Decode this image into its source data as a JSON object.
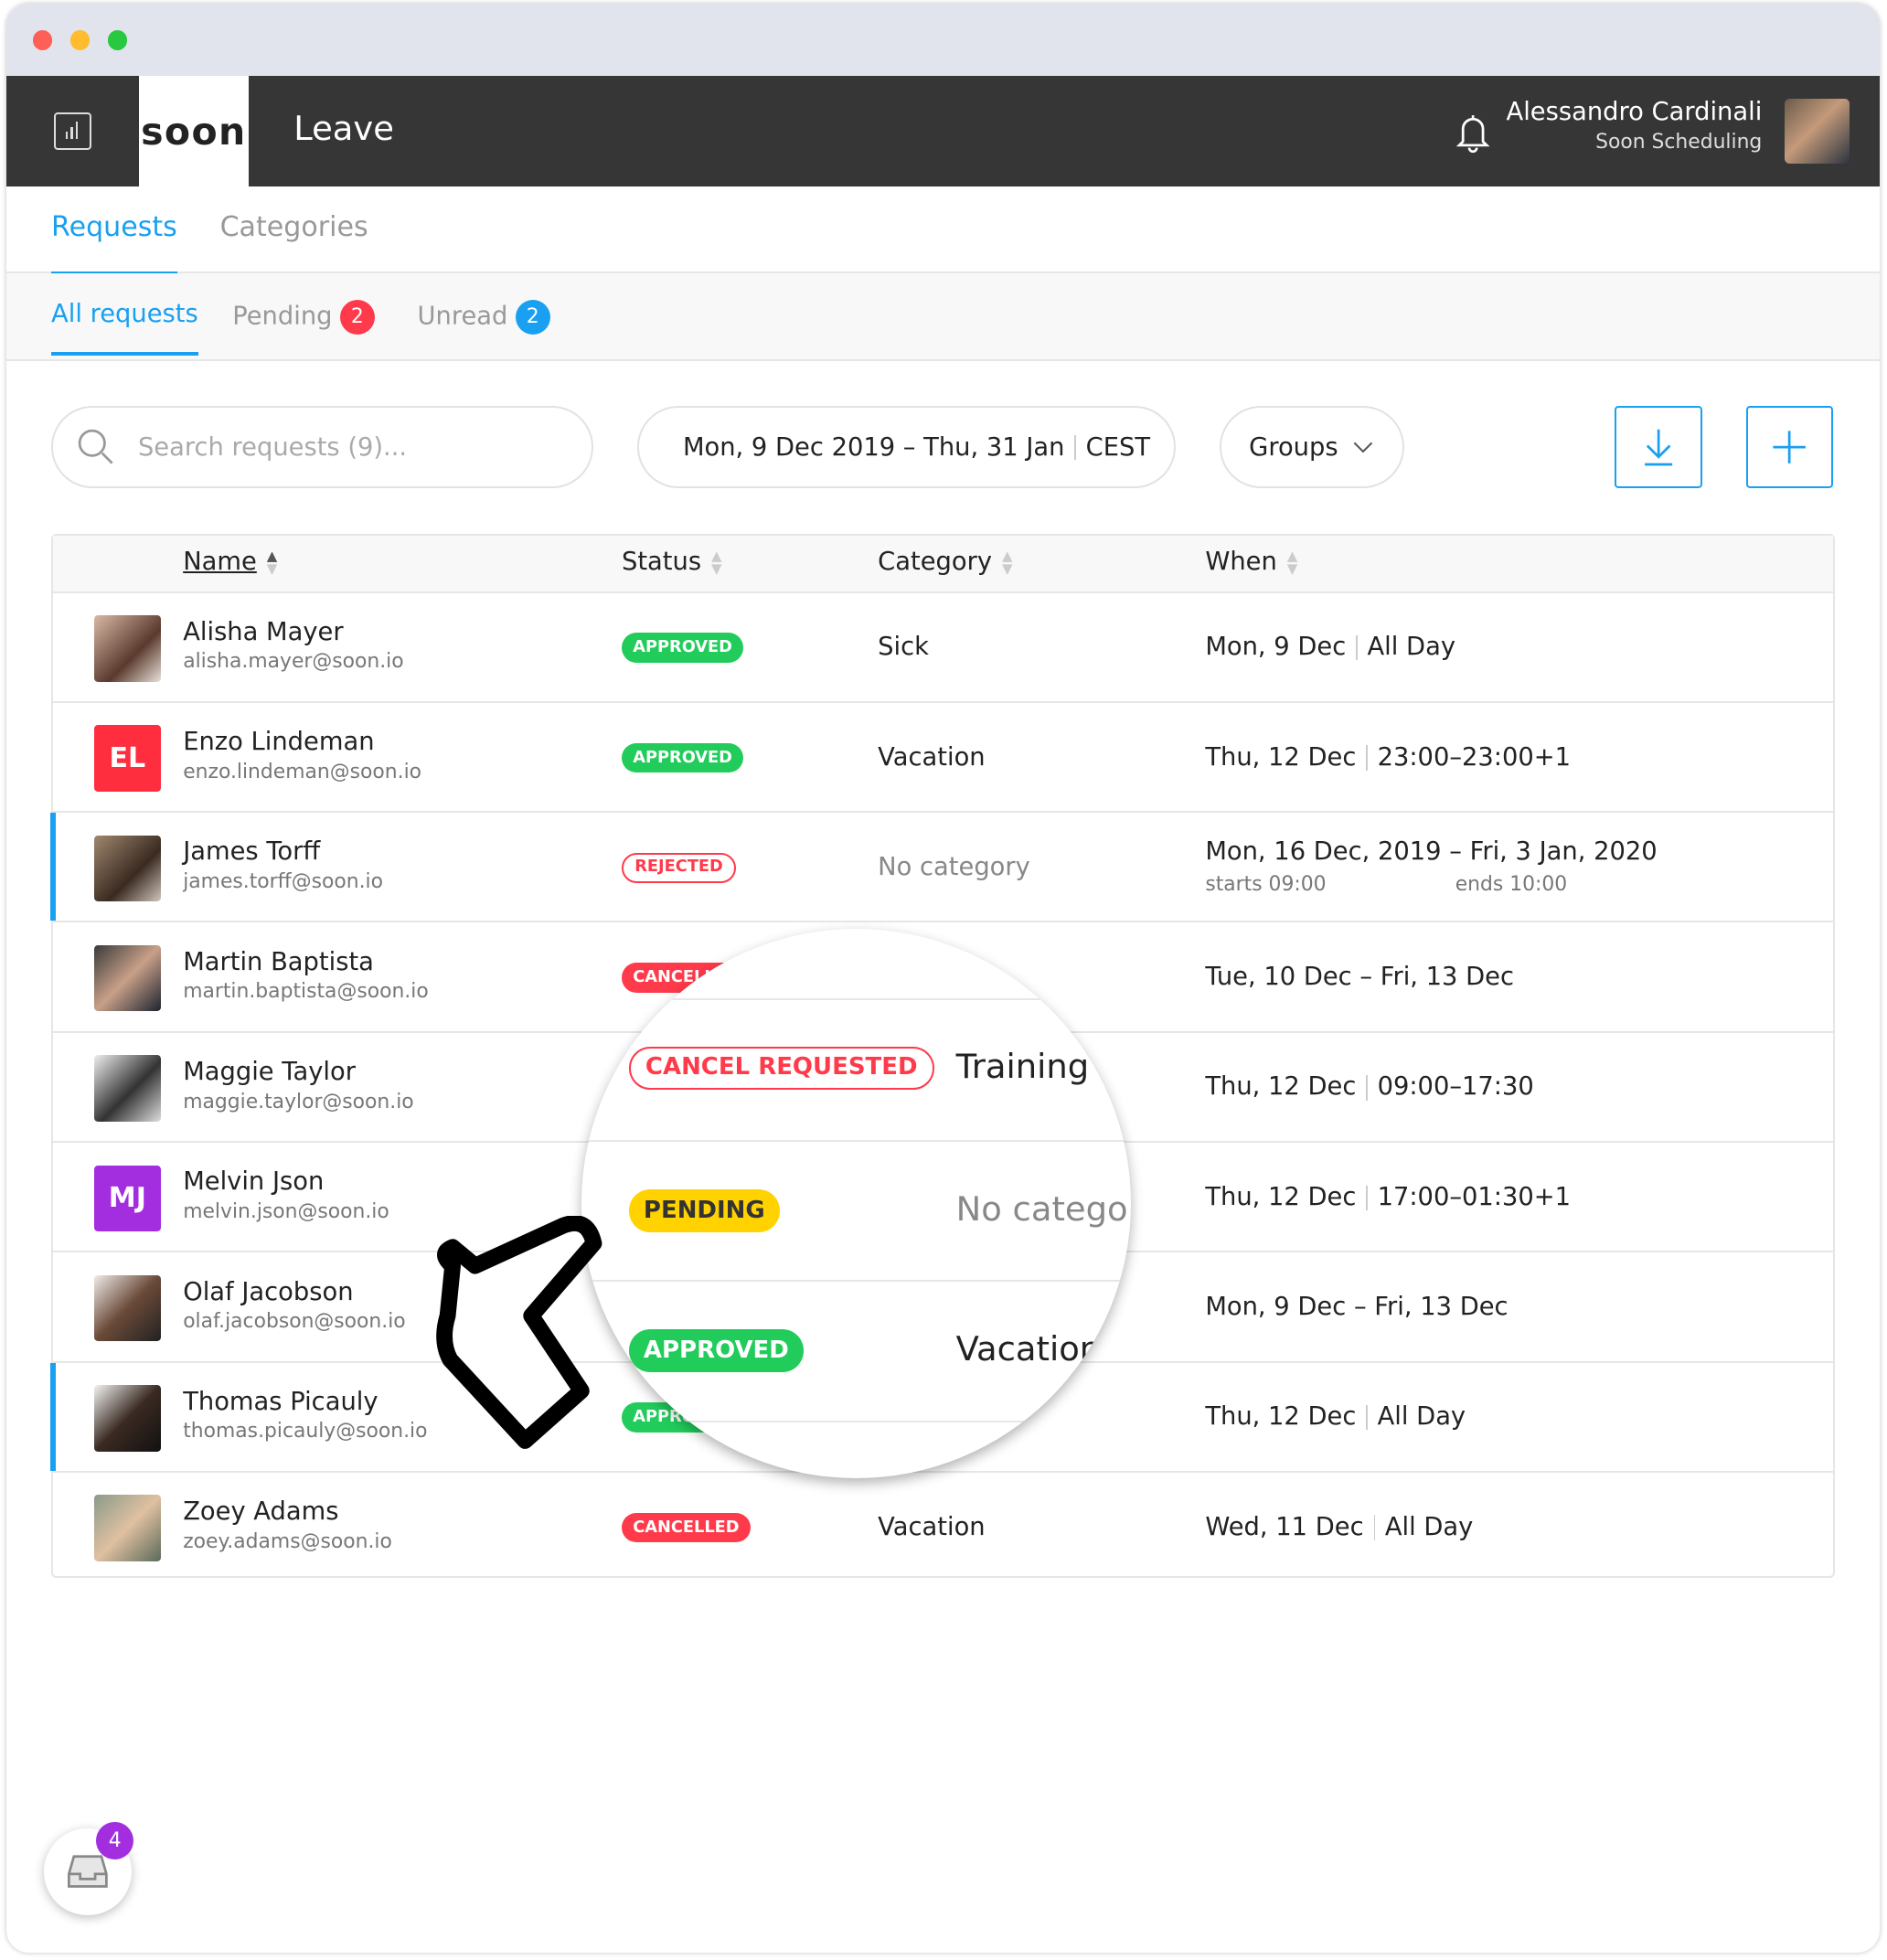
{
  "header": {
    "logo": "soon",
    "title": "Leave",
    "user_name": "Alessandro Cardinali",
    "user_company": "Soon Scheduling"
  },
  "tabs": [
    {
      "label": "Requests",
      "active": true
    },
    {
      "label": "Categories",
      "active": false
    }
  ],
  "subtabs": [
    {
      "label": "All requests",
      "active": true
    },
    {
      "label": "Pending",
      "badge": "2",
      "badge_color": "#ff3a4a"
    },
    {
      "label": "Unread",
      "badge": "2",
      "badge_color": "#1aa0f0"
    }
  ],
  "toolbar": {
    "search_placeholder": "Search requests (9)...",
    "date_range": "Mon, 9 Dec 2019 – Thu, 31 Jan",
    "timezone": "CEST",
    "groups_label": "Groups"
  },
  "table": {
    "columns": [
      "Name",
      "Status",
      "Category",
      "When"
    ],
    "rows": [
      {
        "name": "Alisha Mayer",
        "email": "alisha.mayer@soon.io",
        "status": "APPROVED",
        "category": "Sick",
        "when": "Mon, 9 Dec",
        "when2": "All Day"
      },
      {
        "name": "Enzo Lindeman",
        "email": "enzo.lindeman@soon.io",
        "initials": "EL",
        "status": "APPROVED",
        "category": "Vacation",
        "when": "Thu, 12 Dec",
        "when2": "23:00–23:00+1"
      },
      {
        "name": "James Torff",
        "email": "james.torff@soon.io",
        "status": "REJECTED",
        "category": "No category",
        "when": "Mon, 16 Dec, 2019 – Fri, 3 Jan, 2020",
        "starts": "starts 09:00",
        "ends": "ends 10:00"
      },
      {
        "name": "Martin Baptista",
        "email": "martin.baptista@soon.io",
        "status": "CANCELLED",
        "when": "Tue, 10 Dec – Fri, 13 Dec"
      },
      {
        "name": "Maggie Taylor",
        "email": "maggie.taylor@soon.io",
        "status": "CANCEL REQUESTED",
        "category": "Training",
        "when": "Thu, 12 Dec",
        "when2": "09:00–17:30"
      },
      {
        "name": "Melvin Json",
        "email": "melvin.json@soon.io",
        "initials": "MJ",
        "status": "PENDING",
        "category": "No category",
        "when": "Thu, 12 Dec",
        "when2": "17:00–01:30+1"
      },
      {
        "name": "Olaf Jacobson",
        "email": "olaf.jacobson@soon.io",
        "status": "APPROVED",
        "category": "Vacation",
        "when": "Mon, 9 Dec – Fri, 13 Dec"
      },
      {
        "name": "Thomas Picauly",
        "email": "thomas.picauly@soon.io",
        "status": "APPROVED",
        "when": "Thu, 12 Dec",
        "when2": "All Day"
      },
      {
        "name": "Zoey Adams",
        "email": "zoey.adams@soon.io",
        "status": "CANCELLED",
        "category": "Vacation",
        "when": "Wed, 11 Dec",
        "when2": "All Day"
      }
    ]
  },
  "inbox": {
    "badge": "4"
  },
  "colors": {
    "accent": "#1aa0f0",
    "approved": "#21cc5b",
    "cancelled": "#ff3a4a",
    "pending": "#ffd200",
    "header": "#363636",
    "el_avatar": "#ff2e3e",
    "mj_avatar": "#a22ee0"
  }
}
